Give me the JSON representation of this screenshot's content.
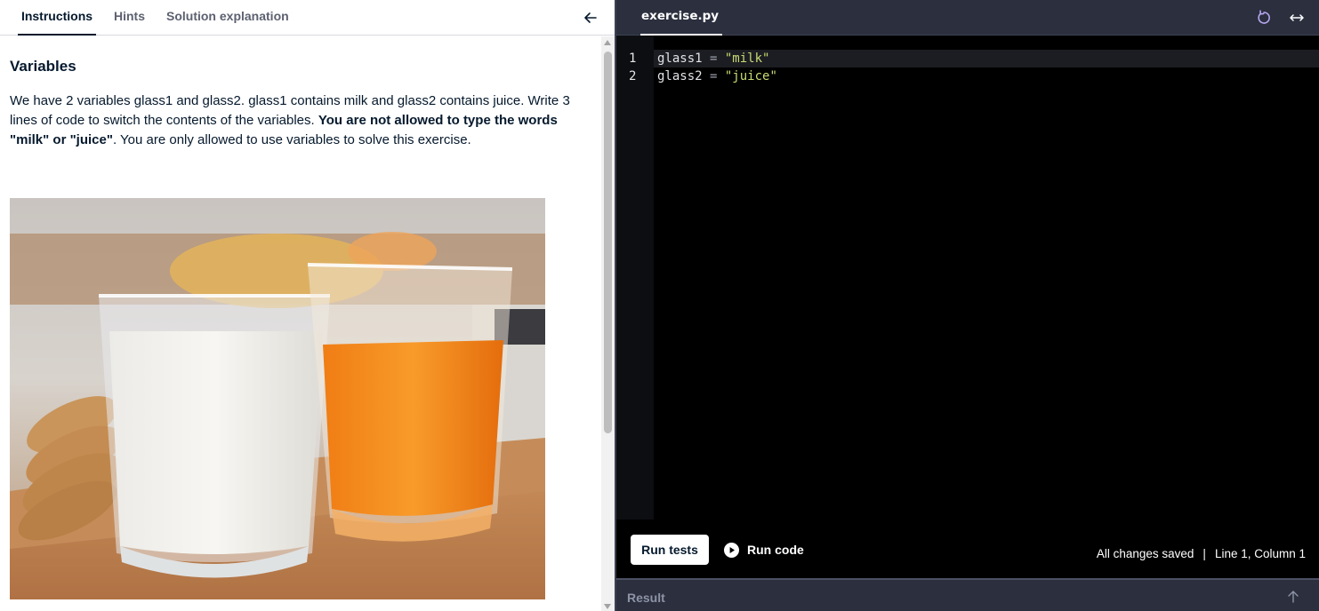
{
  "tabs": [
    {
      "label": "Instructions",
      "active": true
    },
    {
      "label": "Hints",
      "active": false
    },
    {
      "label": "Solution explanation",
      "active": false
    }
  ],
  "content": {
    "heading": "Variables",
    "para_part1": "We have 2 variables glass1 and glass2. glass1 contains milk and glass2 contains juice. Write 3 lines of code to switch the contents of the variables. ",
    "para_bold": "You are not allowed to type the words \"milk\" or \"juice\"",
    "para_part2": ". You are only allowed to use variables to solve this exercise."
  },
  "editor": {
    "file_tab": "exercise.py",
    "lines": [
      {
        "num": "1",
        "var": "glass1",
        "op": " = ",
        "str": "\"milk\""
      },
      {
        "num": "2",
        "var": "glass2",
        "op": " = ",
        "str": "\"juice\""
      }
    ]
  },
  "footer": {
    "run_tests": "Run tests",
    "run_code": "Run code",
    "saved": "All changes saved",
    "separator": "|",
    "position": "Line 1, Column 1"
  },
  "result": {
    "label": "Result"
  },
  "icons": {
    "collapse": "arrow-left-icon",
    "reset": "reset-icon",
    "expand": "expand-horizontal-icon",
    "play": "play-circle-icon",
    "result_toggle": "arrow-up-icon"
  },
  "colors": {
    "brand_navy": "#05192d",
    "editor_header": "#2b2f3e",
    "string_green": "#c7db73"
  }
}
